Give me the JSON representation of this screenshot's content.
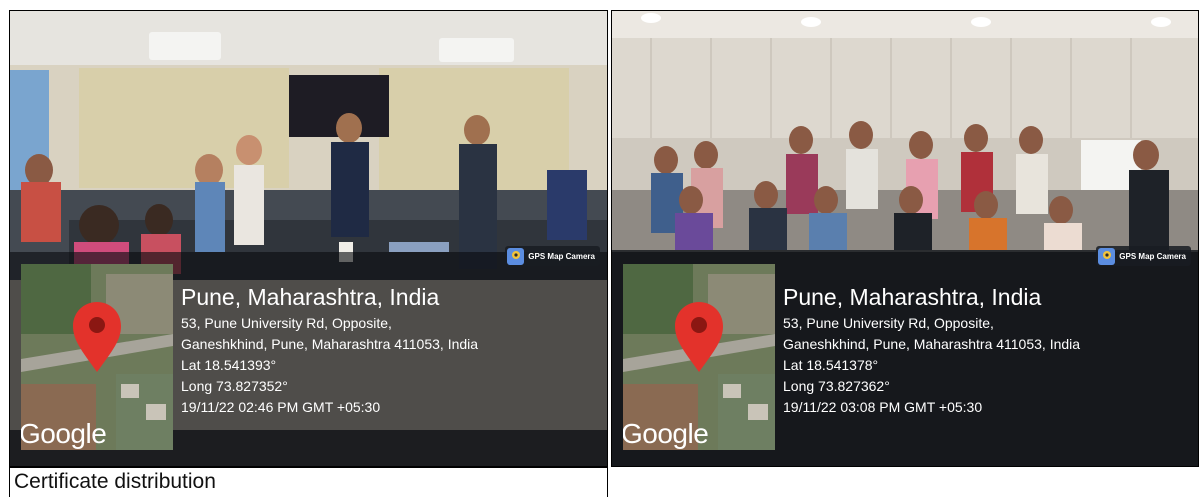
{
  "photos": [
    {
      "badge": "GPS Map Camera",
      "city": "Pune, Maharashtra, India",
      "address_line1": "53, Pune University Rd, Opposite,",
      "address_line2": "Ganeshkhind, Pune, Maharashtra 411053, India",
      "lat": "Lat 18.541393°",
      "long": "Long 73.827352°",
      "timestamp": "19/11/22 02:46 PM GMT +05:30",
      "map_logo": "Google"
    },
    {
      "badge": "GPS Map Camera",
      "city": "Pune, Maharashtra, India",
      "address_line1": "53, Pune University Rd, Opposite,",
      "address_line2": "Ganeshkhind, Pune, Maharashtra 411053, India",
      "lat": "Lat 18.541378°",
      "long": "Long 73.827362°",
      "timestamp": "19/11/22 03:08 PM GMT +05:30",
      "map_logo": "Google"
    }
  ],
  "caption": "Certificate distribution",
  "icons": [
    "map-pin-icon",
    "gps-map-camera-icon"
  ],
  "colors": {
    "pin": "#e3322b",
    "overlay": "#0a0c10"
  }
}
